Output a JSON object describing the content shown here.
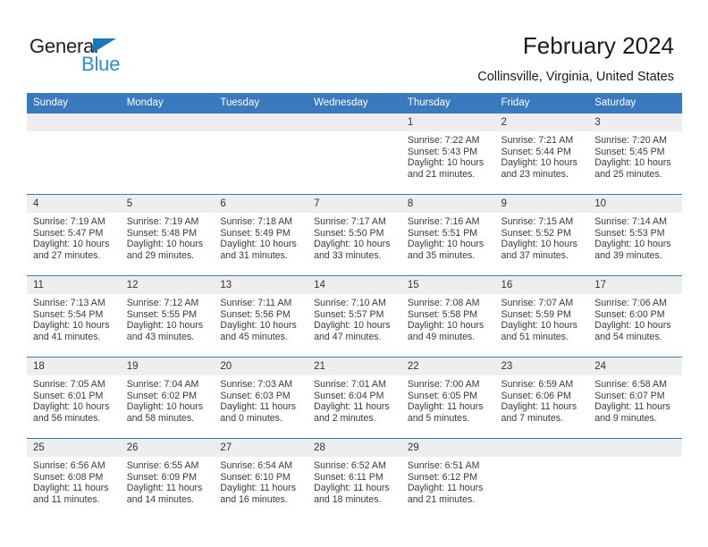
{
  "brand": {
    "name_part1": "General",
    "name_part2": "Blue"
  },
  "header": {
    "title": "February 2024",
    "subtitle": "Collinsville, Virginia, United States"
  },
  "colors": {
    "header_blue": "#3a79bd",
    "logo_blue": "#2e8fd4",
    "logo_dark": "#231f20",
    "daynum_band": "#eeeeee"
  },
  "weekdays": [
    "Sunday",
    "Monday",
    "Tuesday",
    "Wednesday",
    "Thursday",
    "Friday",
    "Saturday"
  ],
  "weeks": [
    [
      {
        "day": "",
        "sunrise": "",
        "sunset": "",
        "daylight1": "",
        "daylight2": ""
      },
      {
        "day": "",
        "sunrise": "",
        "sunset": "",
        "daylight1": "",
        "daylight2": ""
      },
      {
        "day": "",
        "sunrise": "",
        "sunset": "",
        "daylight1": "",
        "daylight2": ""
      },
      {
        "day": "",
        "sunrise": "",
        "sunset": "",
        "daylight1": "",
        "daylight2": ""
      },
      {
        "day": "1",
        "sunrise": "Sunrise: 7:22 AM",
        "sunset": "Sunset: 5:43 PM",
        "daylight1": "Daylight: 10 hours",
        "daylight2": "and 21 minutes."
      },
      {
        "day": "2",
        "sunrise": "Sunrise: 7:21 AM",
        "sunset": "Sunset: 5:44 PM",
        "daylight1": "Daylight: 10 hours",
        "daylight2": "and 23 minutes."
      },
      {
        "day": "3",
        "sunrise": "Sunrise: 7:20 AM",
        "sunset": "Sunset: 5:45 PM",
        "daylight1": "Daylight: 10 hours",
        "daylight2": "and 25 minutes."
      }
    ],
    [
      {
        "day": "4",
        "sunrise": "Sunrise: 7:19 AM",
        "sunset": "Sunset: 5:47 PM",
        "daylight1": "Daylight: 10 hours",
        "daylight2": "and 27 minutes."
      },
      {
        "day": "5",
        "sunrise": "Sunrise: 7:19 AM",
        "sunset": "Sunset: 5:48 PM",
        "daylight1": "Daylight: 10 hours",
        "daylight2": "and 29 minutes."
      },
      {
        "day": "6",
        "sunrise": "Sunrise: 7:18 AM",
        "sunset": "Sunset: 5:49 PM",
        "daylight1": "Daylight: 10 hours",
        "daylight2": "and 31 minutes."
      },
      {
        "day": "7",
        "sunrise": "Sunrise: 7:17 AM",
        "sunset": "Sunset: 5:50 PM",
        "daylight1": "Daylight: 10 hours",
        "daylight2": "and 33 minutes."
      },
      {
        "day": "8",
        "sunrise": "Sunrise: 7:16 AM",
        "sunset": "Sunset: 5:51 PM",
        "daylight1": "Daylight: 10 hours",
        "daylight2": "and 35 minutes."
      },
      {
        "day": "9",
        "sunrise": "Sunrise: 7:15 AM",
        "sunset": "Sunset: 5:52 PM",
        "daylight1": "Daylight: 10 hours",
        "daylight2": "and 37 minutes."
      },
      {
        "day": "10",
        "sunrise": "Sunrise: 7:14 AM",
        "sunset": "Sunset: 5:53 PM",
        "daylight1": "Daylight: 10 hours",
        "daylight2": "and 39 minutes."
      }
    ],
    [
      {
        "day": "11",
        "sunrise": "Sunrise: 7:13 AM",
        "sunset": "Sunset: 5:54 PM",
        "daylight1": "Daylight: 10 hours",
        "daylight2": "and 41 minutes."
      },
      {
        "day": "12",
        "sunrise": "Sunrise: 7:12 AM",
        "sunset": "Sunset: 5:55 PM",
        "daylight1": "Daylight: 10 hours",
        "daylight2": "and 43 minutes."
      },
      {
        "day": "13",
        "sunrise": "Sunrise: 7:11 AM",
        "sunset": "Sunset: 5:56 PM",
        "daylight1": "Daylight: 10 hours",
        "daylight2": "and 45 minutes."
      },
      {
        "day": "14",
        "sunrise": "Sunrise: 7:10 AM",
        "sunset": "Sunset: 5:57 PM",
        "daylight1": "Daylight: 10 hours",
        "daylight2": "and 47 minutes."
      },
      {
        "day": "15",
        "sunrise": "Sunrise: 7:08 AM",
        "sunset": "Sunset: 5:58 PM",
        "daylight1": "Daylight: 10 hours",
        "daylight2": "and 49 minutes."
      },
      {
        "day": "16",
        "sunrise": "Sunrise: 7:07 AM",
        "sunset": "Sunset: 5:59 PM",
        "daylight1": "Daylight: 10 hours",
        "daylight2": "and 51 minutes."
      },
      {
        "day": "17",
        "sunrise": "Sunrise: 7:06 AM",
        "sunset": "Sunset: 6:00 PM",
        "daylight1": "Daylight: 10 hours",
        "daylight2": "and 54 minutes."
      }
    ],
    [
      {
        "day": "18",
        "sunrise": "Sunrise: 7:05 AM",
        "sunset": "Sunset: 6:01 PM",
        "daylight1": "Daylight: 10 hours",
        "daylight2": "and 56 minutes."
      },
      {
        "day": "19",
        "sunrise": "Sunrise: 7:04 AM",
        "sunset": "Sunset: 6:02 PM",
        "daylight1": "Daylight: 10 hours",
        "daylight2": "and 58 minutes."
      },
      {
        "day": "20",
        "sunrise": "Sunrise: 7:03 AM",
        "sunset": "Sunset: 6:03 PM",
        "daylight1": "Daylight: 11 hours",
        "daylight2": "and 0 minutes."
      },
      {
        "day": "21",
        "sunrise": "Sunrise: 7:01 AM",
        "sunset": "Sunset: 6:04 PM",
        "daylight1": "Daylight: 11 hours",
        "daylight2": "and 2 minutes."
      },
      {
        "day": "22",
        "sunrise": "Sunrise: 7:00 AM",
        "sunset": "Sunset: 6:05 PM",
        "daylight1": "Daylight: 11 hours",
        "daylight2": "and 5 minutes."
      },
      {
        "day": "23",
        "sunrise": "Sunrise: 6:59 AM",
        "sunset": "Sunset: 6:06 PM",
        "daylight1": "Daylight: 11 hours",
        "daylight2": "and 7 minutes."
      },
      {
        "day": "24",
        "sunrise": "Sunrise: 6:58 AM",
        "sunset": "Sunset: 6:07 PM",
        "daylight1": "Daylight: 11 hours",
        "daylight2": "and 9 minutes."
      }
    ],
    [
      {
        "day": "25",
        "sunrise": "Sunrise: 6:56 AM",
        "sunset": "Sunset: 6:08 PM",
        "daylight1": "Daylight: 11 hours",
        "daylight2": "and 11 minutes."
      },
      {
        "day": "26",
        "sunrise": "Sunrise: 6:55 AM",
        "sunset": "Sunset: 6:09 PM",
        "daylight1": "Daylight: 11 hours",
        "daylight2": "and 14 minutes."
      },
      {
        "day": "27",
        "sunrise": "Sunrise: 6:54 AM",
        "sunset": "Sunset: 6:10 PM",
        "daylight1": "Daylight: 11 hours",
        "daylight2": "and 16 minutes."
      },
      {
        "day": "28",
        "sunrise": "Sunrise: 6:52 AM",
        "sunset": "Sunset: 6:11 PM",
        "daylight1": "Daylight: 11 hours",
        "daylight2": "and 18 minutes."
      },
      {
        "day": "29",
        "sunrise": "Sunrise: 6:51 AM",
        "sunset": "Sunset: 6:12 PM",
        "daylight1": "Daylight: 11 hours",
        "daylight2": "and 21 minutes."
      },
      {
        "day": "",
        "sunrise": "",
        "sunset": "",
        "daylight1": "",
        "daylight2": ""
      },
      {
        "day": "",
        "sunrise": "",
        "sunset": "",
        "daylight1": "",
        "daylight2": ""
      }
    ]
  ]
}
